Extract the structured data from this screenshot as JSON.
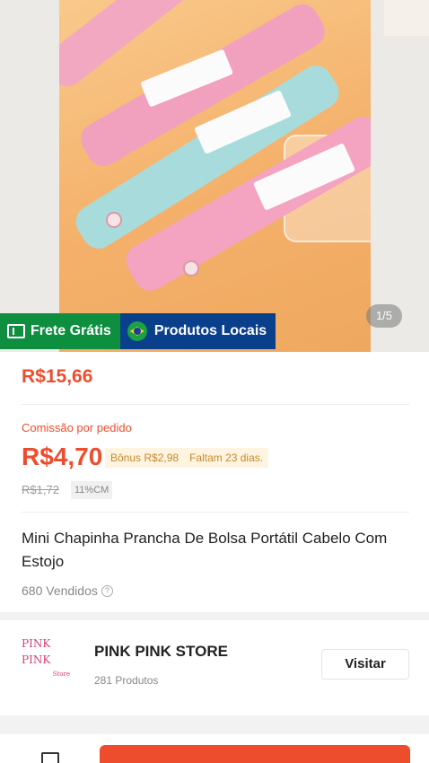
{
  "gallery": {
    "counter": "1/5",
    "tags": {
      "free_shipping": "Frete Grátis",
      "local_products": "Produtos Locais"
    }
  },
  "price": {
    "value": "R$15,66"
  },
  "commission": {
    "label": "Comissão por pedido",
    "value": "R$4,70",
    "bonus": "Bônus R$2,98",
    "days_left": "Faltam 23 dias.",
    "old_value": "R$1,72",
    "rate_tag": "11%CM"
  },
  "product": {
    "title": "Mini Chapinha Prancha De Bolsa Portátil Cabelo Com Estojo",
    "sold": "680 Vendidos"
  },
  "store": {
    "logo_line1": "PINK",
    "logo_line2": "PINK",
    "logo_line3": "Store",
    "name": "PINK PINK STORE",
    "product_count": "281 Produtos",
    "visit_label": "Visitar"
  },
  "colors": {
    "accent": "#ee4d2d",
    "free_shipping_bg": "#0d8f3f",
    "local_products_bg": "#0a3f8c"
  },
  "icons": [
    "truck-icon",
    "brazil-flag-icon",
    "info-icon",
    "store-icon"
  ]
}
